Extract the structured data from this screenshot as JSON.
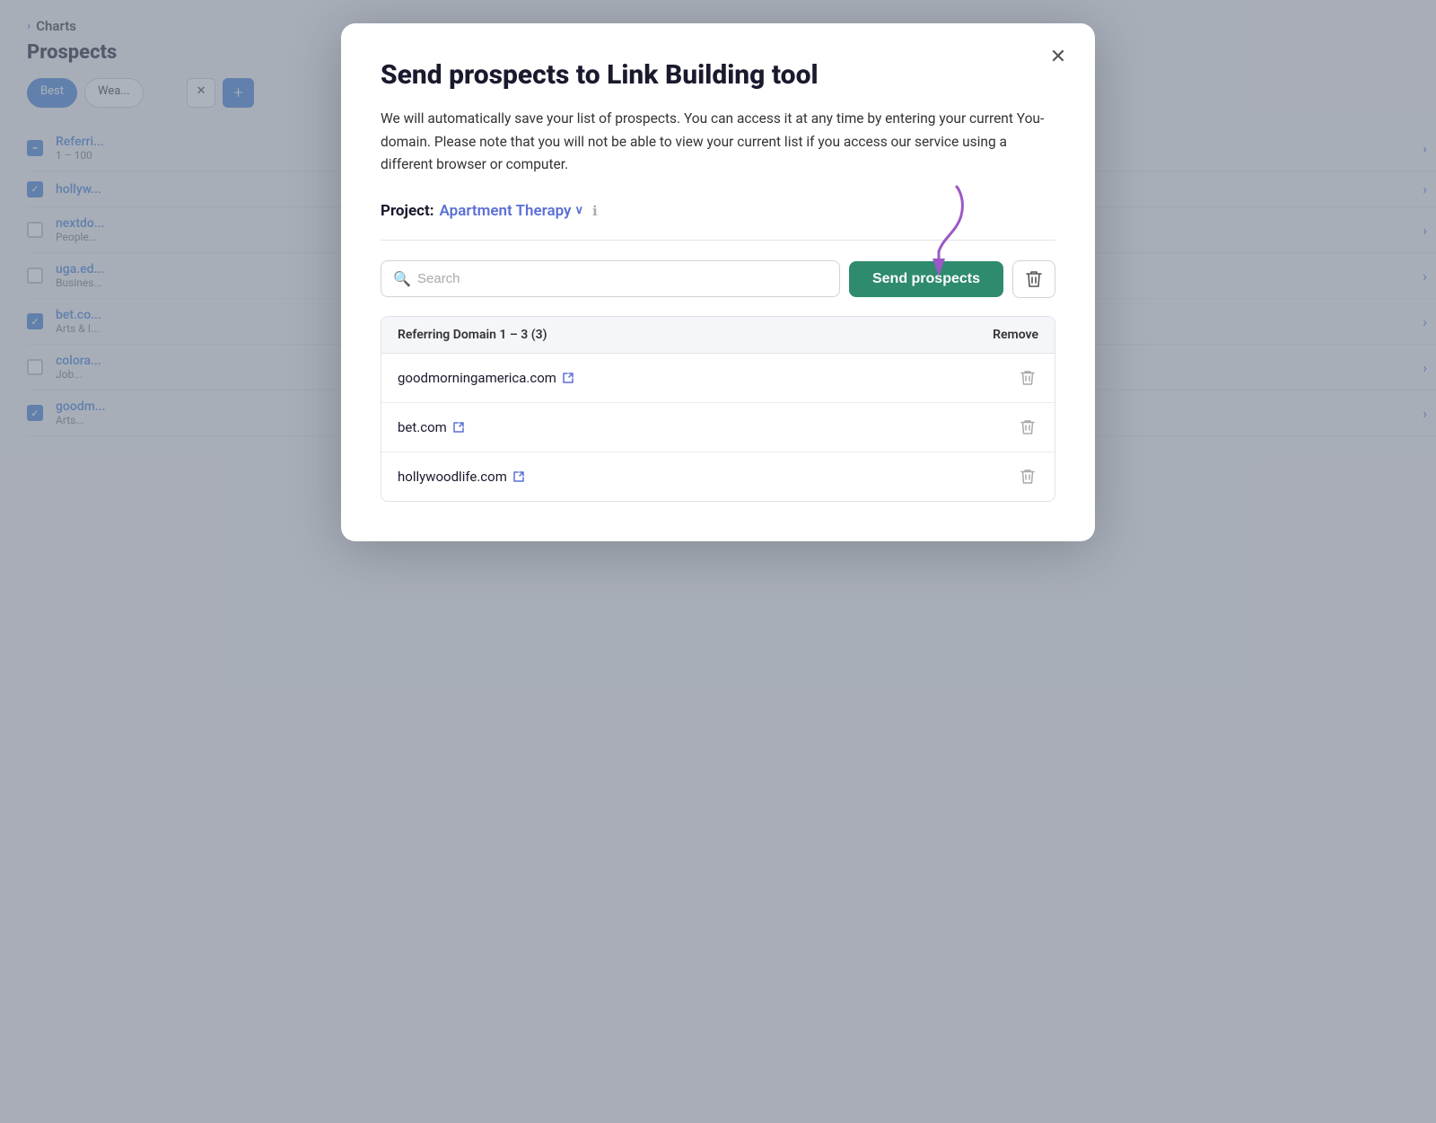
{
  "page": {
    "title": "Prospects"
  },
  "background": {
    "section_charts": "Charts",
    "section_prospects": "Prospects",
    "filters": [
      "Best",
      "Wea..."
    ],
    "rows": [
      {
        "checkbox": "minus",
        "domain": "Referri...",
        "sub": "1 – 100",
        "dot": true
      },
      {
        "checkbox": "checked",
        "domain": "hollyw...",
        "sub": ""
      },
      {
        "checkbox": "unchecked",
        "domain": "nextdo...",
        "sub": "People..."
      },
      {
        "checkbox": "unchecked",
        "domain": "uga.ed...",
        "sub": "Busines..."
      },
      {
        "checkbox": "checked",
        "domain": "bet.co...",
        "sub": "Arts & I..."
      },
      {
        "checkbox": "unchecked",
        "domain": "colora...",
        "sub": "Job..."
      },
      {
        "checkbox": "checked",
        "domain": "goodm...",
        "sub": "Arts..."
      }
    ]
  },
  "modal": {
    "title": "Send prospects to Link Building tool",
    "description": "We will automatically save your list of prospects. You can access it at any time by entering your current You-domain. Please note that you will not be able to view your current list if you access our service using a different browser or computer.",
    "project_label": "Project:",
    "project_name": "Apartment Therapy",
    "close_icon": "✕",
    "search_placeholder": "Search",
    "send_button_label": "Send prospects",
    "delete_icon": "🗑",
    "table": {
      "header_label": "Referring Domain 1 – 3 (3)",
      "header_remove": "Remove",
      "rows": [
        {
          "domain": "goodmorningamerica.com",
          "ext_icon": "↗"
        },
        {
          "domain": "bet.com",
          "ext_icon": "↗"
        },
        {
          "domain": "hollywoodlife.com",
          "ext_icon": "↗"
        }
      ]
    }
  }
}
